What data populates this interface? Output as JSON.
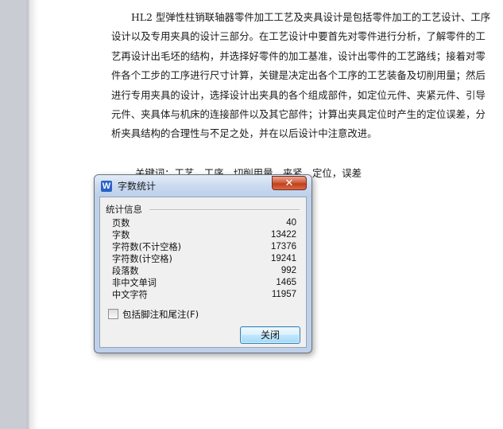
{
  "document": {
    "lines": [
      "HL2 型弹性柱销联轴器零件加工工艺及夹具设计是包括零件加工的工艺设计、工序",
      "设计以及专用夹具的设计三部分。在工艺设计中要首先对零件进行分析，了解零件的工",
      "艺再设计出毛坯的结构，并选择好零件的加工基准，设计出零件的工艺路线；接着对零",
      "件各个工步的工序进行尺寸计算，关键是决定出各个工序的工艺装备及切削用量；然后",
      "进行专用夹具的设计，选择设计出夹具的各个组成部件，如定位元件、夹紧元件、引导",
      "元件、夹具体与机床的连接部件以及其它部件；计算出夹具定位时产生的定位误差，分",
      "析夹具结构的合理性与不足之处，并在以后设计中注意改进。"
    ],
    "keywords": "关键词：工艺，工序，切削用量，夹紧，定位，误差"
  },
  "dialog": {
    "title": "字数统计",
    "app_icon_letter": "W",
    "close_glyph": "✕",
    "group_label": "统计信息",
    "stats": [
      {
        "label": "页数",
        "value": "40"
      },
      {
        "label": "字数",
        "value": "13422"
      },
      {
        "label": "字符数(不计空格)",
        "value": "17376"
      },
      {
        "label": "字符数(计空格)",
        "value": "19241"
      },
      {
        "label": "段落数",
        "value": "992"
      },
      {
        "label": "非中文单词",
        "value": "1465"
      },
      {
        "label": "中文字符",
        "value": "11957"
      }
    ],
    "checkbox_label": "包括脚注和尾注(F)",
    "checkbox_checked": false,
    "close_button_label": "关闭"
  },
  "colors": {
    "title_close_red": "#c2401c",
    "button_blue": "#3c7fb1",
    "app_icon_blue": "#2a62c8"
  }
}
